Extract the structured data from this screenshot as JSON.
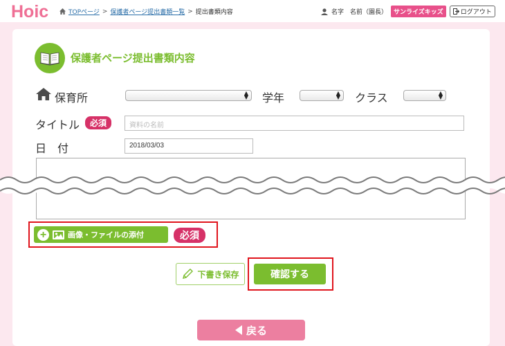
{
  "header": {
    "logo_text": "Hoic",
    "breadcrumb": [
      {
        "label": "TOPページ"
      },
      {
        "label": "保護者ページ提出書類一覧"
      },
      {
        "label": "提出書類内容"
      }
    ],
    "breadcrumb_sep": ">",
    "user_label": "名字　名前（園長）",
    "facility_badge": "サンライズキッズ",
    "logout_label": "ログアウト"
  },
  "page_title": "保護者ページ提出書類内容",
  "form": {
    "nursery_label": "保育所",
    "nursery_value": "",
    "grade_label": "学年",
    "grade_value": "",
    "class_label": "クラス",
    "class_value": "",
    "title_label": "タイトル",
    "required_badge": "必須",
    "title_placeholder": "資料の名前",
    "date_label": "日　付",
    "date_value": "2018/03/03",
    "body_value": ""
  },
  "attach": {
    "label": "画像・ファイルの添付",
    "required_badge": "必須"
  },
  "actions": {
    "draft_label": "下書き保存",
    "confirm_label": "確認する",
    "back_label": "戻る"
  },
  "colors": {
    "accent_green": "#7bbd2f",
    "required_pink": "#d63167",
    "back_pink": "#ec7fa0",
    "highlight_red": "#e0141c",
    "background_pink": "#fce8ef"
  },
  "icons": {
    "home": "home-icon",
    "user": "user-icon",
    "book": "book-icon",
    "plus": "plus-circle-icon",
    "image": "image-icon",
    "pencil": "pencil-icon",
    "back": "triangle-left-icon",
    "logout": "logout-icon"
  }
}
